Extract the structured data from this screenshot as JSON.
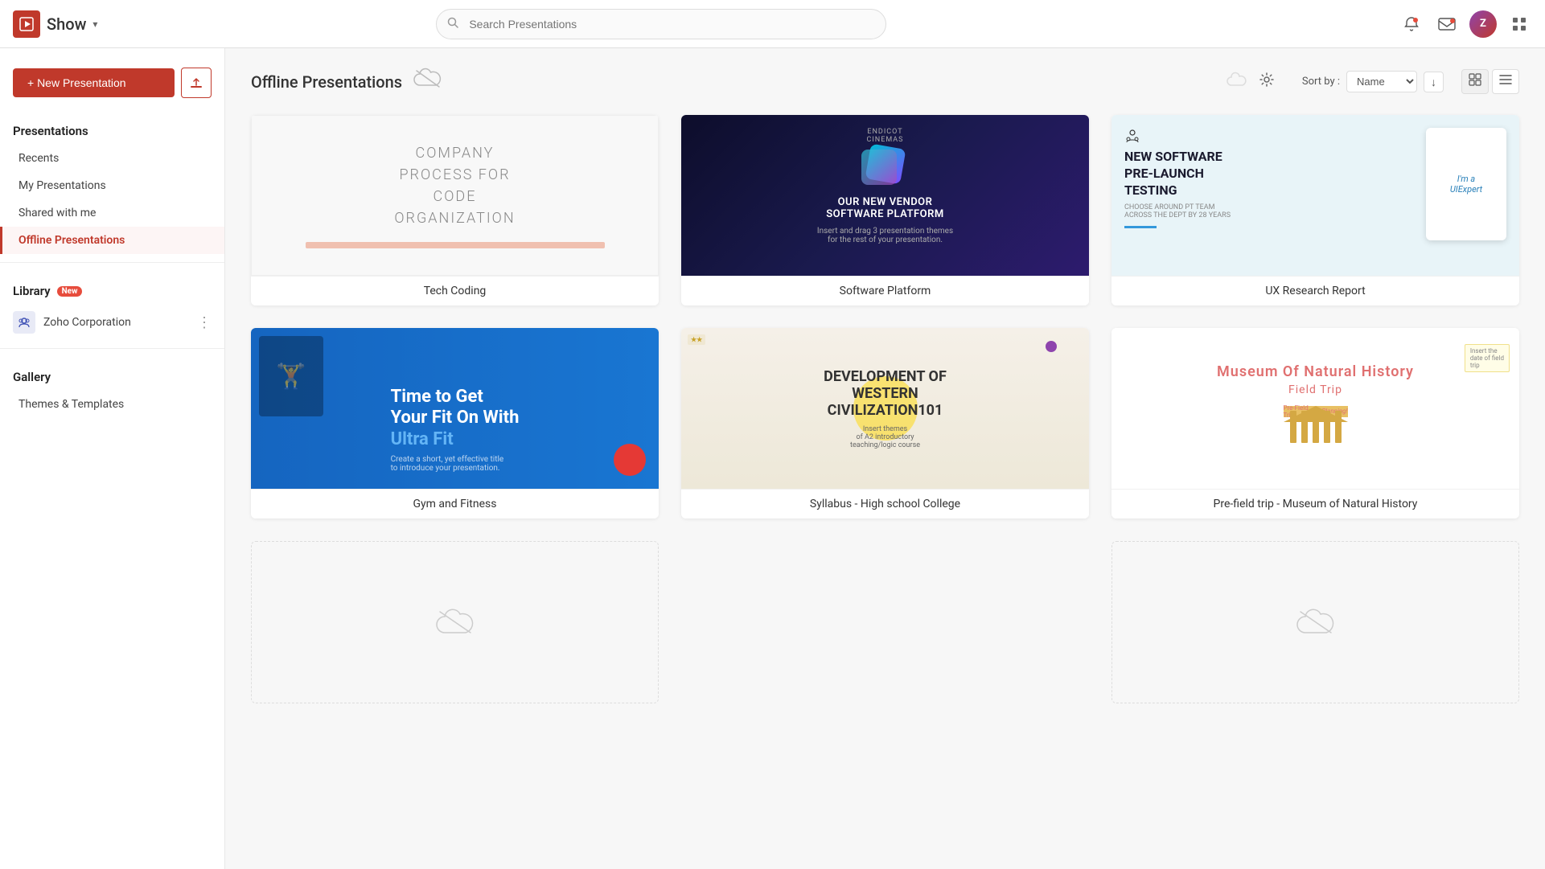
{
  "app": {
    "name": "Show",
    "logo_text": "Show"
  },
  "topnav": {
    "search_placeholder": "Search Presentations",
    "notifications_icon": "🔔",
    "mail_icon": "✉",
    "grid_icon": "⋮⋮⋮"
  },
  "sidebar": {
    "new_presentation_label": "+ New Presentation",
    "upload_label": "↑",
    "presentations_section": "Presentations",
    "recents_label": "Recents",
    "my_presentations_label": "My Presentations",
    "shared_with_me_label": "Shared with me",
    "offline_label": "Offline Presentations",
    "library_section": "Library",
    "library_badge": "New",
    "library_item": "Zoho Corporation",
    "gallery_section": "Gallery",
    "themes_templates_label": "Themes & Templates"
  },
  "content": {
    "title": "Offline Presentations",
    "sort_label": "Sort by :",
    "sort_option": "Name",
    "settings_icon": "⚙",
    "grid_view_icon": "▦",
    "list_view_icon": "☰",
    "presentations": [
      {
        "id": "tech-coding",
        "label": "Tech Coding",
        "type": "tech"
      },
      {
        "id": "software-platform",
        "label": "Software Platform",
        "type": "software"
      },
      {
        "id": "ux-research",
        "label": "UX Research Report",
        "type": "ux"
      },
      {
        "id": "gym-fitness",
        "label": "Gym and Fitness",
        "type": "gym"
      },
      {
        "id": "syllabus",
        "label": "Syllabus - High school College",
        "type": "syllabus"
      },
      {
        "id": "museum",
        "label": "Pre-field trip - Museum of Natural History",
        "type": "museum"
      }
    ]
  }
}
